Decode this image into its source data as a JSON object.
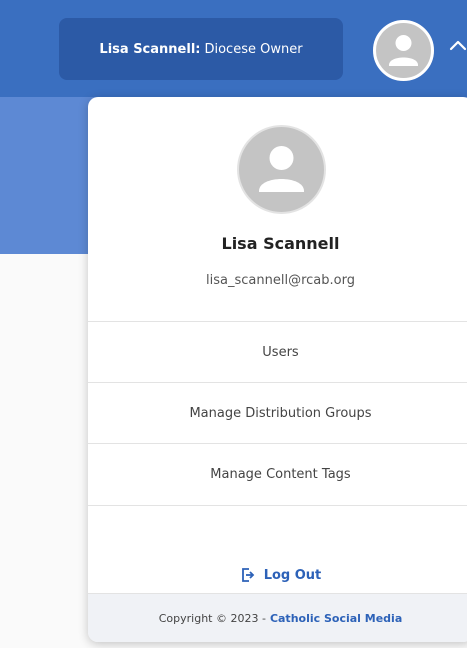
{
  "header": {
    "user_chip": {
      "name": "Lisa Scannell:",
      "role": "Diocese Owner"
    },
    "avatar_icon": "user-avatar-icon",
    "chevron_icon": "chevron-up-icon"
  },
  "profile_menu": {
    "avatar_icon": "user-avatar-icon",
    "name": "Lisa Scannell",
    "email": "lisa_scannell@rcab.org",
    "items": [
      {
        "label": "Users"
      },
      {
        "label": "Manage Distribution Groups"
      },
      {
        "label": "Manage Content Tags"
      }
    ],
    "logout": {
      "label": "Log Out",
      "icon": "logout-icon"
    },
    "footer": {
      "copyright": "Copyright © 2023 -",
      "brand": "Catholic Social Media"
    }
  },
  "colors": {
    "topbar": "#3a6fc0",
    "chip_bg": "#2c5aa6",
    "accent": "#2d62b8",
    "avatar_gray": "#c4c4c4"
  }
}
